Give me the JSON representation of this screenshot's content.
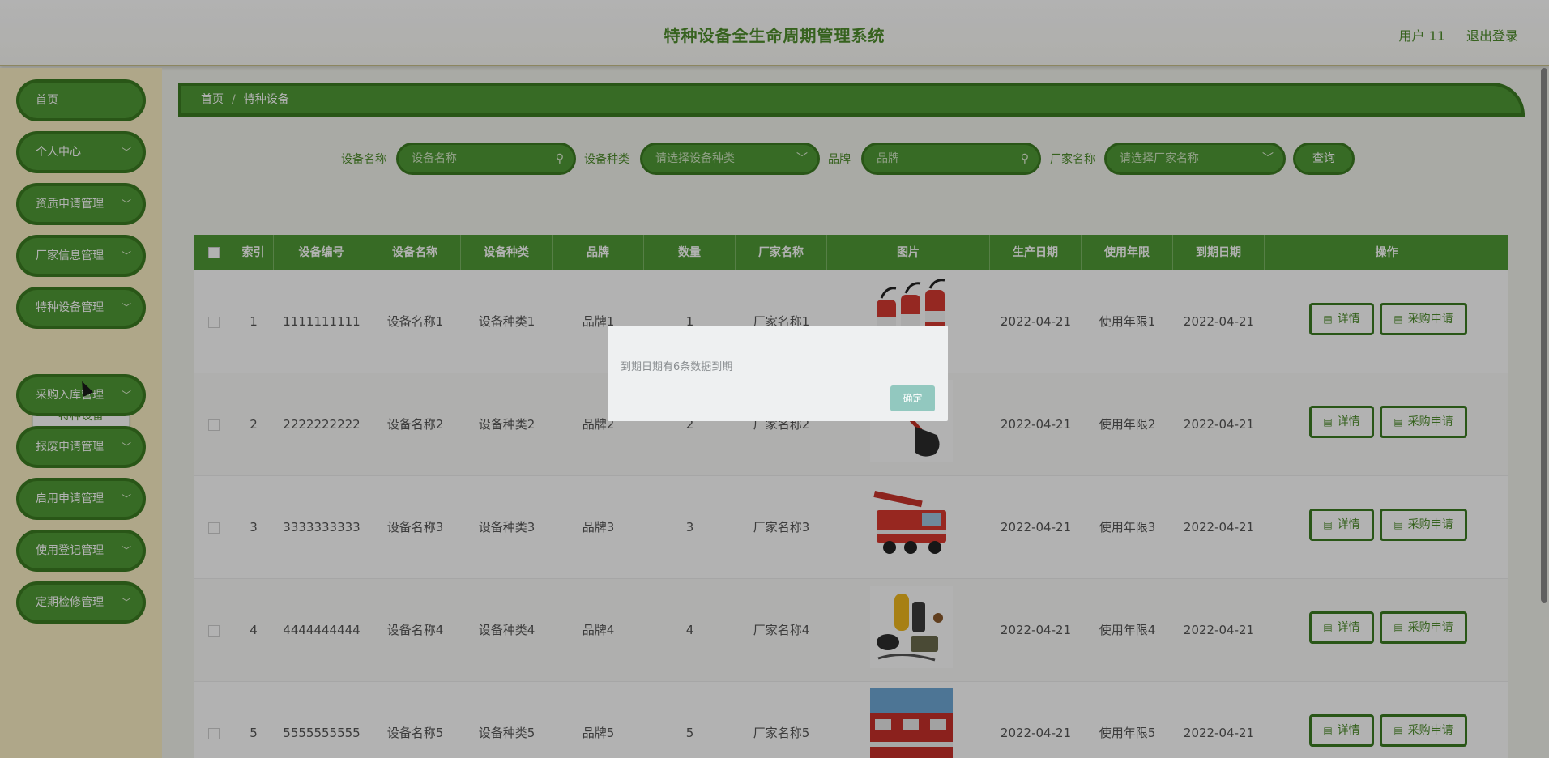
{
  "header": {
    "title": "特种设备全生命周期管理系统",
    "user": "用户 11",
    "logout": "退出登录"
  },
  "sidebar": {
    "items": [
      {
        "label": "首页",
        "has_children": false
      },
      {
        "label": "个人中心",
        "has_children": true
      },
      {
        "label": "资质申请管理",
        "has_children": true
      },
      {
        "label": "厂家信息管理",
        "has_children": true
      },
      {
        "label": "特种设备管理",
        "has_children": true
      },
      {
        "label": "采购入库管理",
        "has_children": true
      },
      {
        "label": "报废申请管理",
        "has_children": true
      },
      {
        "label": "启用申请管理",
        "has_children": true
      },
      {
        "label": "使用登记管理",
        "has_children": true
      },
      {
        "label": "定期检修管理",
        "has_children": true
      }
    ],
    "active_submenu": "特种设备"
  },
  "breadcrumb": {
    "home": "首页",
    "sep": "/",
    "current": "特种设备"
  },
  "search": {
    "name_label": "设备名称",
    "name_placeholder": "设备名称",
    "type_label": "设备种类",
    "type_placeholder": "请选择设备种类",
    "brand_label": "品牌",
    "brand_placeholder": "品牌",
    "maker_label": "厂家名称",
    "maker_placeholder": "请选择厂家名称",
    "query": "查询"
  },
  "table": {
    "headers": [
      "索引",
      "设备编号",
      "设备名称",
      "设备种类",
      "品牌",
      "数量",
      "厂家名称",
      "图片",
      "生产日期",
      "使用年限",
      "到期日期",
      "操作"
    ],
    "rows": [
      {
        "idx": "1",
        "code": "1111111111",
        "name": "设备名称1",
        "type": "设备种类1",
        "brand": "品牌1",
        "qty": "1",
        "maker": "厂家名称1",
        "image": "fire-extinguishers",
        "prod_date": "2022-04-21",
        "life": "使用年限1",
        "expire": "2022-04-21"
      },
      {
        "idx": "2",
        "code": "2222222222",
        "name": "设备名称2",
        "type": "设备种类2",
        "brand": "品牌2",
        "qty": "2",
        "maker": "厂家名称2",
        "image": "shovel",
        "prod_date": "2022-04-21",
        "life": "使用年限2",
        "expire": "2022-04-21"
      },
      {
        "idx": "3",
        "code": "3333333333",
        "name": "设备名称3",
        "type": "设备种类3",
        "brand": "品牌3",
        "qty": "3",
        "maker": "厂家名称3",
        "image": "fire-truck-ladder",
        "prod_date": "2022-04-21",
        "life": "使用年限3",
        "expire": "2022-04-21"
      },
      {
        "idx": "4",
        "code": "4444444444",
        "name": "设备名称4",
        "type": "设备种类4",
        "brand": "品牌4",
        "qty": "4",
        "maker": "厂家名称4",
        "image": "breathing-apparatus",
        "prod_date": "2022-04-21",
        "life": "使用年限4",
        "expire": "2022-04-21"
      },
      {
        "idx": "5",
        "code": "5555555555",
        "name": "设备名称5",
        "type": "设备种类5",
        "brand": "品牌5",
        "qty": "5",
        "maker": "厂家名称5",
        "image": "fire-trucks",
        "prod_date": "2022-04-21",
        "life": "使用年限5",
        "expire": "2022-04-21"
      }
    ],
    "actions": {
      "detail": "详情",
      "purchase": "采购申请"
    }
  },
  "dialog": {
    "message": "到期日期有6条数据到期",
    "ok": "确定"
  },
  "colors": {
    "accent": "#4f9a35",
    "accent_border": "#3c7b22",
    "title": "#4e8d2c",
    "sidebar_bg": "#fbefc5",
    "dialog_ok": "#92c8bf"
  }
}
